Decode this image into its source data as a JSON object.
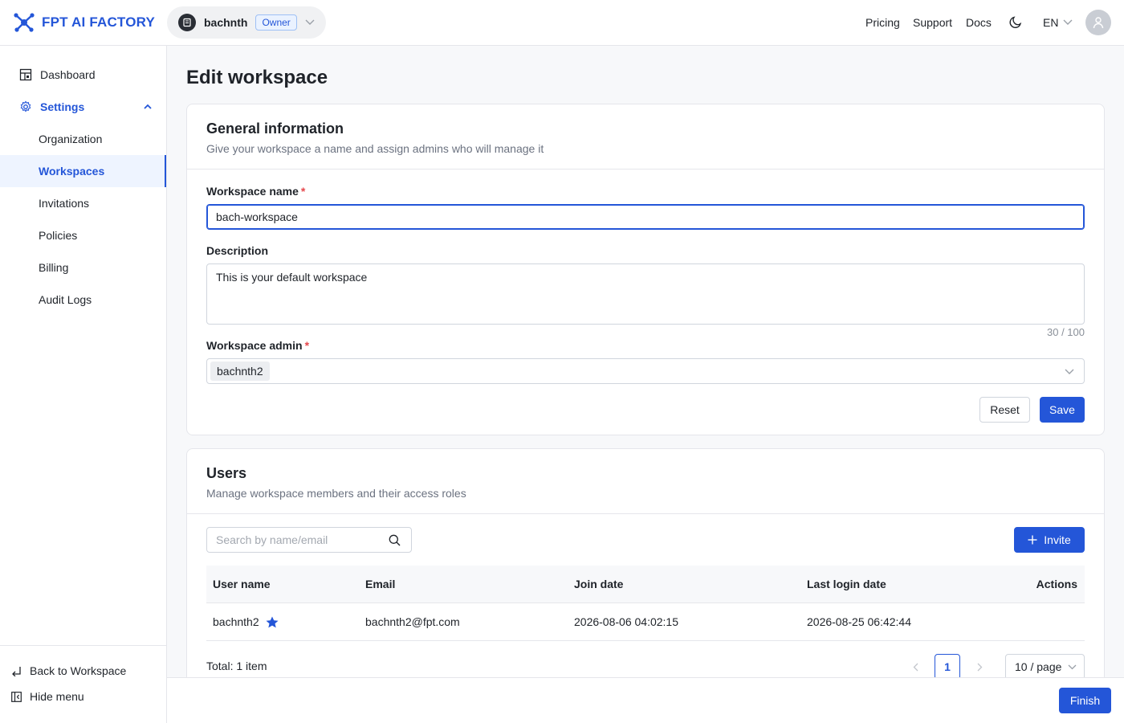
{
  "brand": {
    "name": "FPT AI FACTORY",
    "color": "#2456d8"
  },
  "workspace_switcher": {
    "name": "bachnth",
    "role_badge": "Owner"
  },
  "header_nav": {
    "pricing": "Pricing",
    "support": "Support",
    "docs": "Docs",
    "language": "EN"
  },
  "sidebar": {
    "dashboard": "Dashboard",
    "settings": "Settings",
    "items": [
      "Organization",
      "Workspaces",
      "Invitations",
      "Policies",
      "Billing",
      "Audit Logs"
    ],
    "active": "Workspaces",
    "back": "Back to Workspace",
    "hide": "Hide menu"
  },
  "page": {
    "title": "Edit workspace"
  },
  "general": {
    "title": "General information",
    "subtitle": "Give your workspace a name and assign admins who will manage it",
    "name_label": "Workspace name",
    "name_value": "bach-workspace",
    "description_label": "Description",
    "description_value": "This is your default workspace",
    "description_counter": "30 / 100",
    "admin_label": "Workspace admin",
    "admin_tag": "bachnth2",
    "required_mark": "*",
    "reset_label": "Reset",
    "save_label": "Save"
  },
  "users": {
    "title": "Users",
    "subtitle": "Manage workspace members and their access roles",
    "search_placeholder": "Search by name/email",
    "invite_label": "Invite",
    "columns": {
      "user": "User name",
      "email": "Email",
      "join": "Join date",
      "last_login": "Last login date",
      "actions": "Actions"
    },
    "rows": [
      {
        "user": "bachnth2",
        "email": "bachnth2@fpt.com",
        "join": "2026-08-06 04:02:15",
        "last_login": "2026-08-25 06:42:44"
      }
    ],
    "total": "Total: 1 item",
    "current_page": "1",
    "page_size": "10 / page"
  },
  "footer": {
    "finish_label": "Finish"
  }
}
